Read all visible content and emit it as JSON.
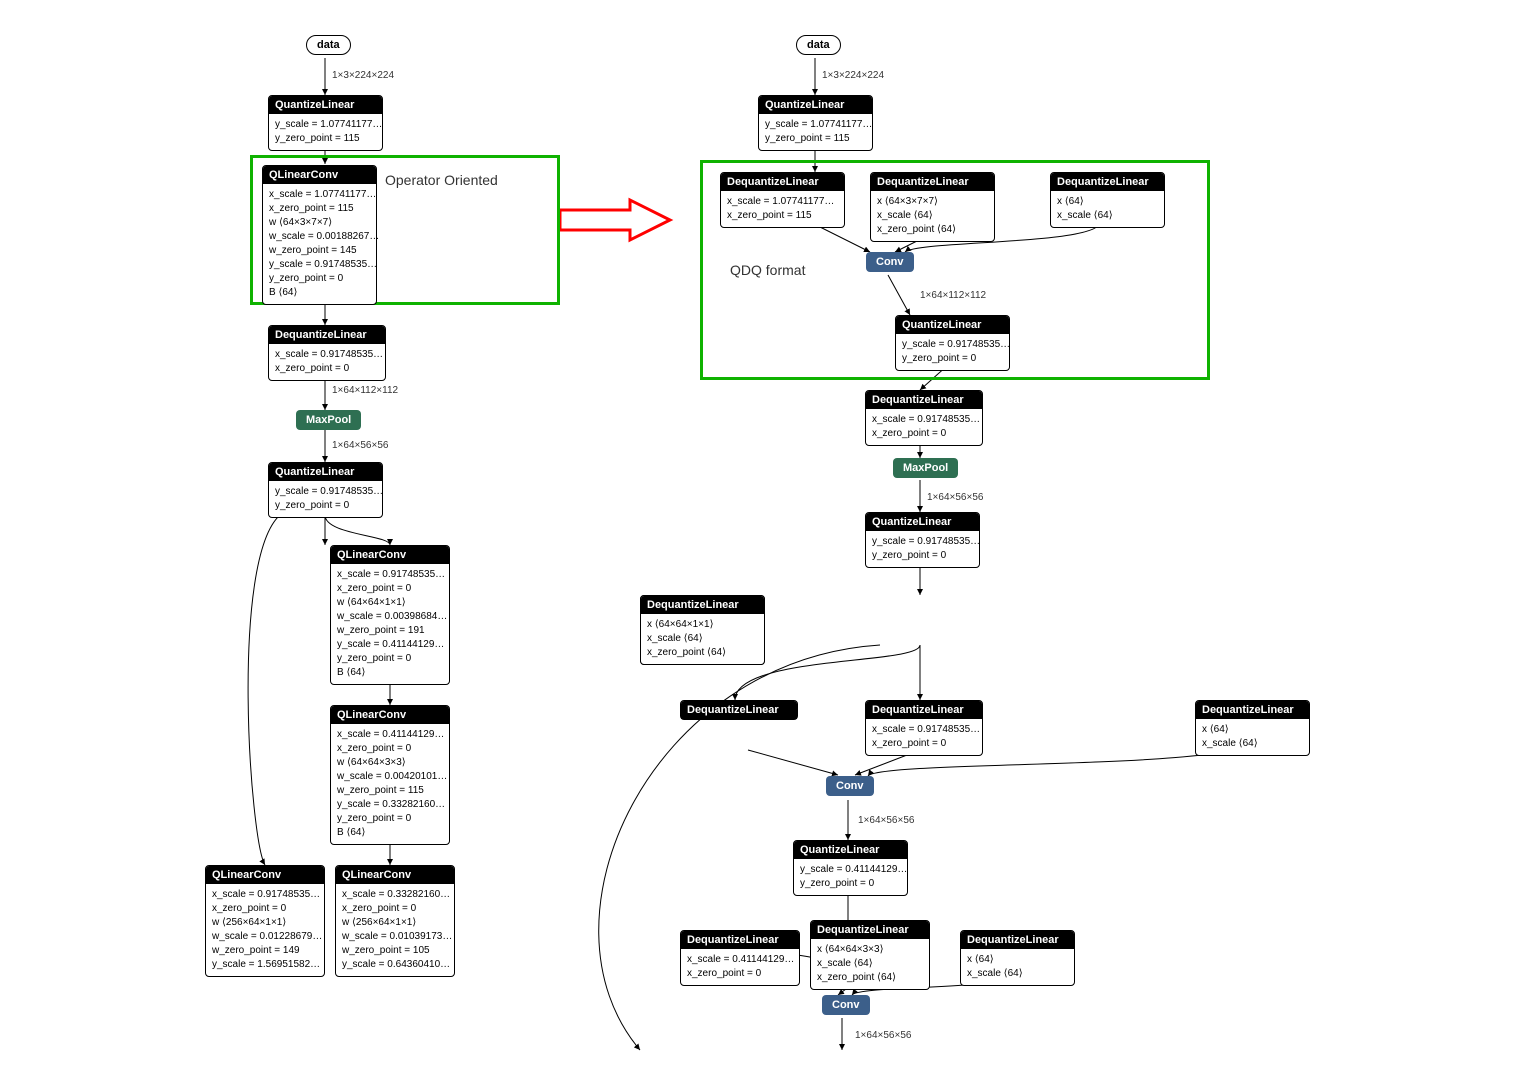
{
  "left": {
    "annotation": "Operator Oriented",
    "data_node": "data",
    "shape1": "1×3×224×224",
    "qlin1": {
      "title": "QuantizeLinear",
      "l1": "y_scale = 1.07741177…",
      "l2": "y_zero_point = 115"
    },
    "qconv1": {
      "title": "QLinearConv",
      "l1": "x_scale = 1.07741177…",
      "l2": "x_zero_point = 115",
      "l3": "w ⟨64×3×7×7⟩",
      "l4": "w_scale = 0.00188267…",
      "l5": "w_zero_point = 145",
      "l6": "y_scale = 0.91748535…",
      "l7": "y_zero_point = 0",
      "l8": "B ⟨64⟩"
    },
    "dqlin1": {
      "title": "DequantizeLinear",
      "l1": "x_scale = 0.91748535…",
      "l2": "x_zero_point = 0"
    },
    "shape2": "1×64×112×112",
    "maxpool": "MaxPool",
    "shape3": "1×64×56×56",
    "qlin2": {
      "title": "QuantizeLinear",
      "l1": "y_scale = 0.91748535…",
      "l2": "y_zero_point = 0"
    },
    "qconv2": {
      "title": "QLinearConv",
      "l1": "x_scale = 0.91748535…",
      "l2": "x_zero_point = 0",
      "l3": "w ⟨64×64×1×1⟩",
      "l4": "w_scale = 0.00398684…",
      "l5": "w_zero_point = 191",
      "l6": "y_scale = 0.41144129…",
      "l7": "y_zero_point = 0",
      "l8": "B ⟨64⟩"
    },
    "qconv3": {
      "title": "QLinearConv",
      "l1": "x_scale = 0.41144129…",
      "l2": "x_zero_point = 0",
      "l3": "w ⟨64×64×3×3⟩",
      "l4": "w_scale = 0.00420101…",
      "l5": "w_zero_point = 115",
      "l6": "y_scale = 0.33282160…",
      "l7": "y_zero_point = 0",
      "l8": "B ⟨64⟩"
    },
    "qconv4": {
      "title": "QLinearConv",
      "l1": "x_scale = 0.91748535…",
      "l2": "x_zero_point = 0",
      "l3": "w ⟨256×64×1×1⟩",
      "l4": "w_scale = 0.01228679…",
      "l5": "w_zero_point = 149",
      "l6": "y_scale = 1.56951582…"
    },
    "qconv5": {
      "title": "QLinearConv",
      "l1": "x_scale = 0.33282160…",
      "l2": "x_zero_point = 0",
      "l3": "w ⟨256×64×1×1⟩",
      "l4": "w_scale = 0.01039173…",
      "l5": "w_zero_point = 105",
      "l6": "y_scale = 0.64360410…"
    }
  },
  "right": {
    "annotation": "QDQ format",
    "data_node": "data",
    "shape1": "1×3×224×224",
    "qlin1": {
      "title": "QuantizeLinear",
      "l1": "y_scale = 1.07741177…",
      "l2": "y_zero_point = 115"
    },
    "dq1": {
      "title": "DequantizeLinear",
      "l1": "x_scale = 1.07741177…",
      "l2": "x_zero_point = 115"
    },
    "dq2": {
      "title": "DequantizeLinear",
      "l1": "x ⟨64×3×7×7⟩",
      "l2": "x_scale ⟨64⟩",
      "l3": "x_zero_point ⟨64⟩"
    },
    "dq3": {
      "title": "DequantizeLinear",
      "l1": "x ⟨64⟩",
      "l2": "x_scale ⟨64⟩"
    },
    "conv1": "Conv",
    "shape2": "1×64×112×112",
    "qlin2": {
      "title": "QuantizeLinear",
      "l1": "y_scale = 0.91748535…",
      "l2": "y_zero_point = 0"
    },
    "dq4": {
      "title": "DequantizeLinear",
      "l1": "x_scale = 0.91748535…",
      "l2": "x_zero_point = 0"
    },
    "maxpool": "MaxPool",
    "shape3": "1×64×56×56",
    "qlin3": {
      "title": "QuantizeLinear",
      "l1": "y_scale = 0.91748535…",
      "l2": "y_zero_point = 0"
    },
    "dq5": {
      "title": "DequantizeLinear",
      "l1": "x ⟨64×64×1×1⟩",
      "l2": "x_scale ⟨64⟩",
      "l3": "x_zero_point ⟨64⟩"
    },
    "dq6": {
      "title": "DequantizeLinear",
      "l1": "x_scale = 0.91748535…",
      "l2": "x_zero_point = 0"
    },
    "dq7": {
      "title": "DequantizeLinear",
      "l1": "x ⟨64⟩",
      "l2": "x_scale ⟨64⟩"
    },
    "conv2": "Conv",
    "shape4": "1×64×56×56",
    "qlin4": {
      "title": "QuantizeLinear",
      "l1": "y_scale = 0.41144129…",
      "l2": "y_zero_point = 0"
    },
    "dq8": {
      "title": "DequantizeLinear",
      "l1": "x_scale = 0.41144129…",
      "l2": "x_zero_point = 0"
    },
    "dq9": {
      "title": "DequantizeLinear",
      "l1": "x ⟨64×64×3×3⟩",
      "l2": "x_scale ⟨64⟩",
      "l3": "x_zero_point ⟨64⟩"
    },
    "dq10": {
      "title": "DequantizeLinear",
      "l1": "x ⟨64⟩",
      "l2": "x_scale ⟨64⟩"
    },
    "conv3": "Conv",
    "shape5": "1×64×56×56"
  }
}
